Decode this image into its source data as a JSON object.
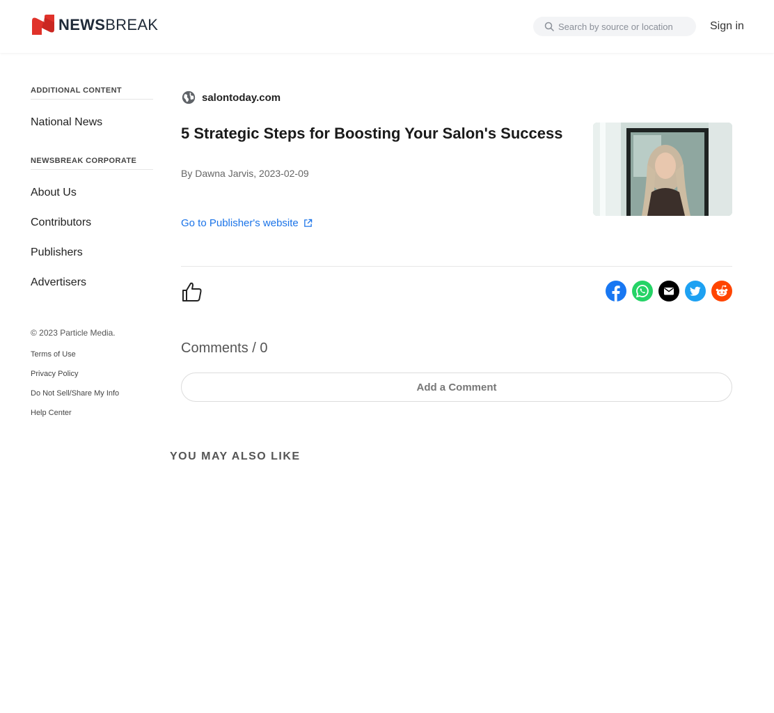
{
  "header": {
    "logo": {
      "news": "NEWS",
      "break": "BREAK",
      "brand_color": "#e0322a"
    },
    "search": {
      "placeholder": "Search by source or location",
      "icon": "search-icon"
    },
    "signin_label": "Sign in"
  },
  "sidebar": {
    "sections": [
      {
        "heading": "ADDITIONAL CONTENT",
        "items": [
          "National News"
        ]
      },
      {
        "heading": "NEWSBREAK CORPORATE",
        "items": [
          "About Us",
          "Contributors",
          "Publishers",
          "Advertisers"
        ]
      }
    ],
    "copyright": "© 2023 Particle Media.",
    "footer_links": [
      "Terms of Use",
      "Privacy Policy",
      "Do Not Sell/Share My Info",
      "Help Center"
    ]
  },
  "article": {
    "source": "salontoday.com",
    "source_icon": "globe-icon",
    "title": "5 Strategic Steps for Boosting Your Salon's Success",
    "byline": "By Dawna Jarvis, 2023-02-09",
    "publisher_link": "Go to Publisher's website",
    "link_color": "#1a73e8"
  },
  "actions": {
    "like_icon": "thumbs-up-icon",
    "share": [
      {
        "name": "facebook",
        "color": "#1877f2"
      },
      {
        "name": "whatsapp",
        "color": "#25d366"
      },
      {
        "name": "email",
        "color": "#000000"
      },
      {
        "name": "twitter",
        "color": "#1da1f2"
      },
      {
        "name": "reddit",
        "color": "#ff4500"
      }
    ]
  },
  "comments": {
    "label": "Comments / 0",
    "add_label": "Add a Comment"
  },
  "recommendations": {
    "heading": "YOU MAY ALSO LIKE"
  }
}
